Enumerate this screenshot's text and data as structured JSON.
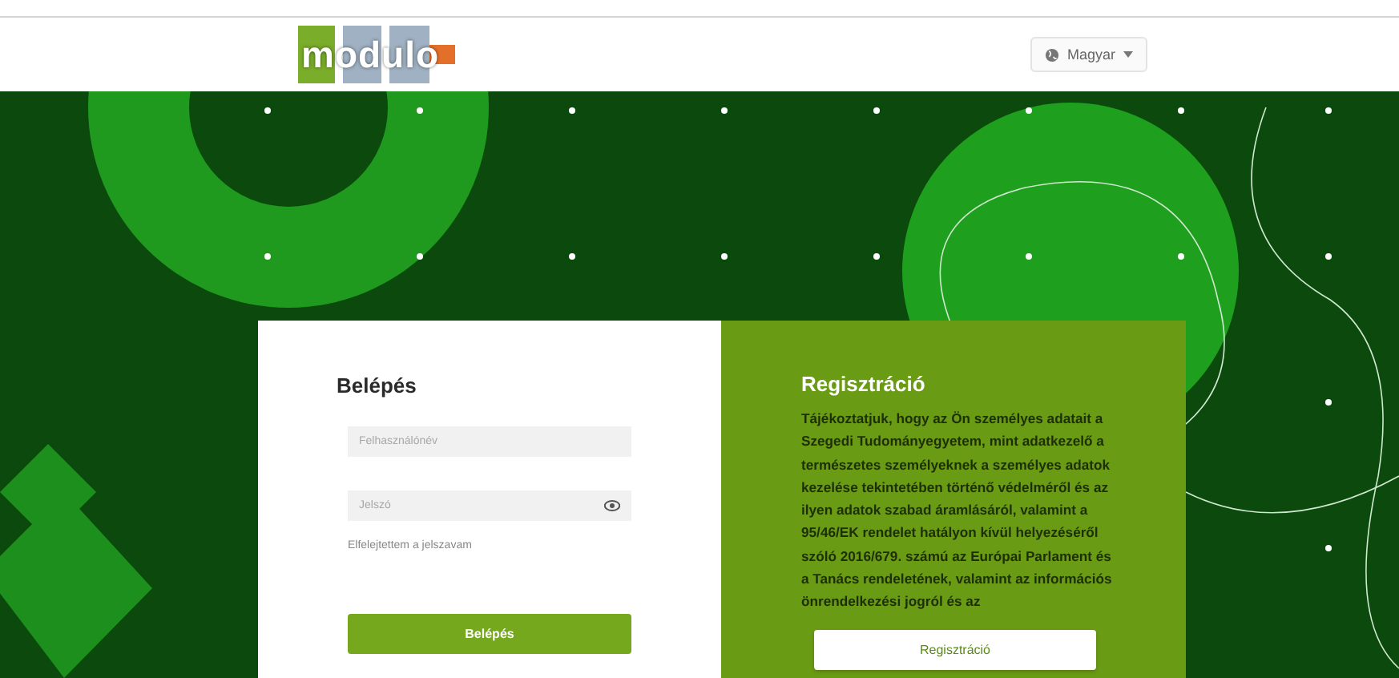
{
  "header": {
    "logo": "modulo",
    "language": "Magyar"
  },
  "login": {
    "title": "Belépés",
    "username": {
      "placeholder": "Felhasználónév"
    },
    "password": {
      "placeholder": "Jelszó"
    },
    "forgot_link": "Elfelejtettem a jelszavam",
    "submit": "Belépés"
  },
  "registration": {
    "title": "Regisztráció",
    "notice": "Tájékoztatjuk, hogy az Ön személyes adatait a Szegedi Tudományegyetem, mint adatkezelő a természetes személyeknek a személyes adatok kezelése tekintetében történő védelméről és az ilyen adatok szabad áramlásáról, valamint a 95/46/EK rendelet hatályon kívül helyezéséről szóló 2016/679. számú az Európai Parlament és a Tanács rendeletének, valamint az információs önrendelkezési jogról és az",
    "button": "Regisztráció"
  }
}
